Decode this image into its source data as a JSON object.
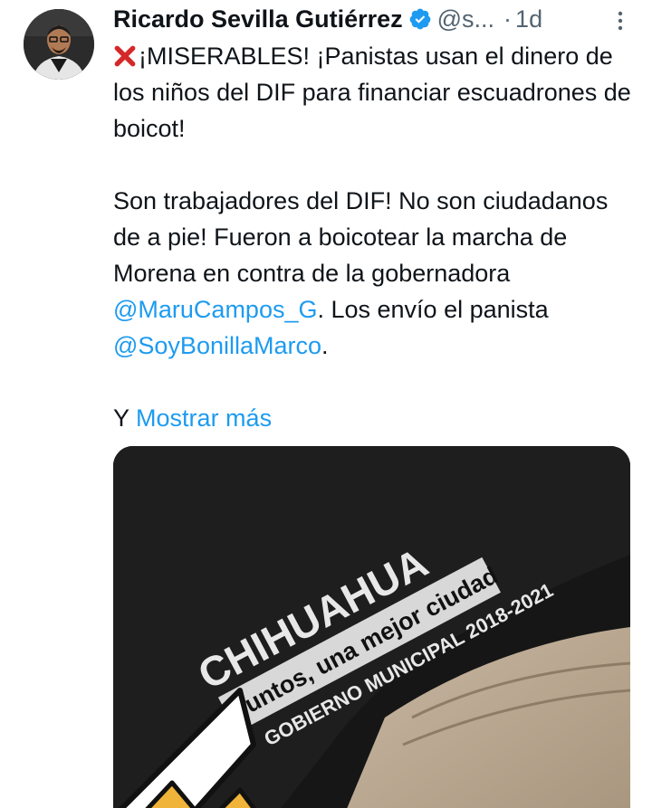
{
  "tweet": {
    "author_name": "Ricardo Sevilla Gutiérrez",
    "handle": "@s...",
    "dot": "·",
    "time": "1d",
    "body_line1": "¡MISERABLES! ¡Panistas usan el dinero de los niños del DIF para financiar escuadrones de boicot!",
    "body_p2_text": "Son trabajadores del DIF! No son ciudadanos de a pie! Fueron a boicotear la marcha de Morena en contra de la gobernadora ",
    "mention1": "@MaruCampos_G",
    "body_p2_mid": ". Los envío el panista ",
    "mention2": "@SoyBonillaMarco",
    "body_p2_end": ".",
    "body_p3": "Y",
    "show_more": "Mostrar más"
  },
  "media": {
    "cap_line1": "CHIHUAHUA",
    "cap_line2": "Juntos, una mejor ciudad",
    "cap_line3": "GOBIERNO MUNICIPAL 2018-2021"
  },
  "colors": {
    "link": "#1d9bf0",
    "text": "#0f1419",
    "secondary": "#536471",
    "verified": "#1d9bf0",
    "x_mark": "#d62828"
  },
  "icons": {
    "verified": "verified-badge-icon",
    "x_mark": "cross-mark-emoji-icon",
    "more": "more-options-icon"
  }
}
